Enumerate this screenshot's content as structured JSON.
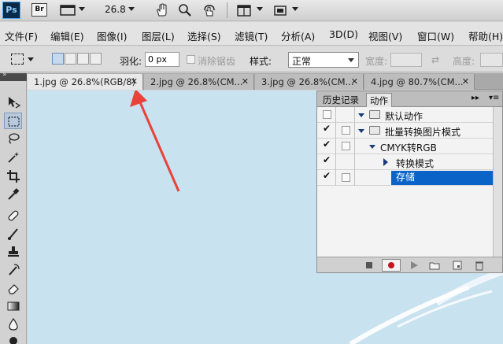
{
  "appbar": {
    "logo": "Ps",
    "bridge": "Br",
    "zoom": "26.8",
    "icons": [
      "bridge-icon",
      "frame-icon",
      "hand-icon",
      "zoom-icon",
      "rotate-icon",
      "arrange-icon",
      "screen-mode-icon"
    ]
  },
  "menubar": {
    "items": [
      "文件(F)",
      "编辑(E)",
      "图像(I)",
      "图层(L)",
      "选择(S)",
      "滤镜(T)",
      "分析(A)",
      "3D(D)",
      "视图(V)",
      "窗口(W)",
      "帮助(H)"
    ]
  },
  "options": {
    "feather_label": "羽化:",
    "feather_value": "0 px",
    "antialias_label": "消除锯齿",
    "style_label": "样式:",
    "style_value": "正常",
    "width_label": "宽度:",
    "height_label": "高度:"
  },
  "doc_tabs": [
    {
      "title": "1.jpg @ 26.8%(RGB/8)",
      "active": true
    },
    {
      "title": "2.jpg @ 26.8%(CM...",
      "active": false
    },
    {
      "title": "3.jpg @ 26.8%(CM...",
      "active": false
    },
    {
      "title": "4.jpg @ 80.7%(CM...",
      "active": false
    }
  ],
  "actions_panel": {
    "tabs": [
      "历史记录",
      "动作"
    ],
    "active_tab": "动作",
    "rows": [
      {
        "label": "默认动作",
        "type": "set",
        "checked": false,
        "dialog": false,
        "expanded": true
      },
      {
        "label": "批量转换图片模式",
        "type": "set",
        "checked": true,
        "dialog": false,
        "expanded": true
      },
      {
        "label": "CMYK转RGB",
        "type": "action",
        "checked": true,
        "dialog": false,
        "expanded": true
      },
      {
        "label": "转换模式",
        "type": "step",
        "checked": true,
        "dialog": false,
        "expanded": false
      },
      {
        "label": "存储",
        "type": "step",
        "checked": true,
        "dialog": false,
        "selected": true
      }
    ]
  },
  "colors": {
    "canvas": "#c9e2f0",
    "selection": "#0a64c8",
    "arrow": "#e8423a"
  }
}
